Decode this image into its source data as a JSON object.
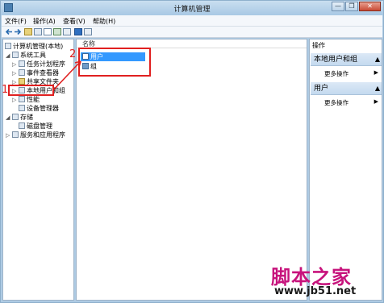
{
  "window": {
    "title": "计算机管理"
  },
  "window_buttons": {
    "minimize": "—",
    "restore": "❐",
    "close": "✕"
  },
  "menu": [
    {
      "label": "文件(F)"
    },
    {
      "label": "操作(A)"
    },
    {
      "label": "查看(V)"
    },
    {
      "label": "帮助(H)"
    }
  ],
  "tree": [
    {
      "label": "计算机管理(本地)",
      "twisty": ""
    },
    {
      "label": "系统工具",
      "twisty": "◢"
    },
    {
      "label": "任务计划程序",
      "twisty": "▷"
    },
    {
      "label": "事件查看器",
      "twisty": "▷"
    },
    {
      "label": "共享文件夹",
      "twisty": "▷"
    },
    {
      "label": "本地用户和组",
      "twisty": "▷"
    },
    {
      "label": "性能",
      "twisty": "▷"
    },
    {
      "label": "设备管理器",
      "twisty": ""
    },
    {
      "label": "存储",
      "twisty": "◢"
    },
    {
      "label": "磁盘管理",
      "twisty": ""
    },
    {
      "label": "服务和应用程序",
      "twisty": "▷"
    }
  ],
  "list": {
    "column_header": "名称",
    "items": [
      {
        "label": "用户"
      },
      {
        "label": "组"
      }
    ]
  },
  "actions": {
    "title": "操作",
    "sections": [
      {
        "header": "本地用户和组",
        "item": "更多操作",
        "arrow": "▶"
      },
      {
        "header": "用户",
        "item": "更多操作",
        "arrow": "▶"
      }
    ]
  },
  "annotations": {
    "marker1": "1",
    "marker2": "2",
    "annotation_color": "#e02020"
  },
  "watermark": {
    "text": "脚本之家",
    "url": "www.jb51.net"
  },
  "colors": {
    "window_frame": "#aecbe4",
    "selection": "#3399ff",
    "watermark_text": "#c7137c"
  }
}
